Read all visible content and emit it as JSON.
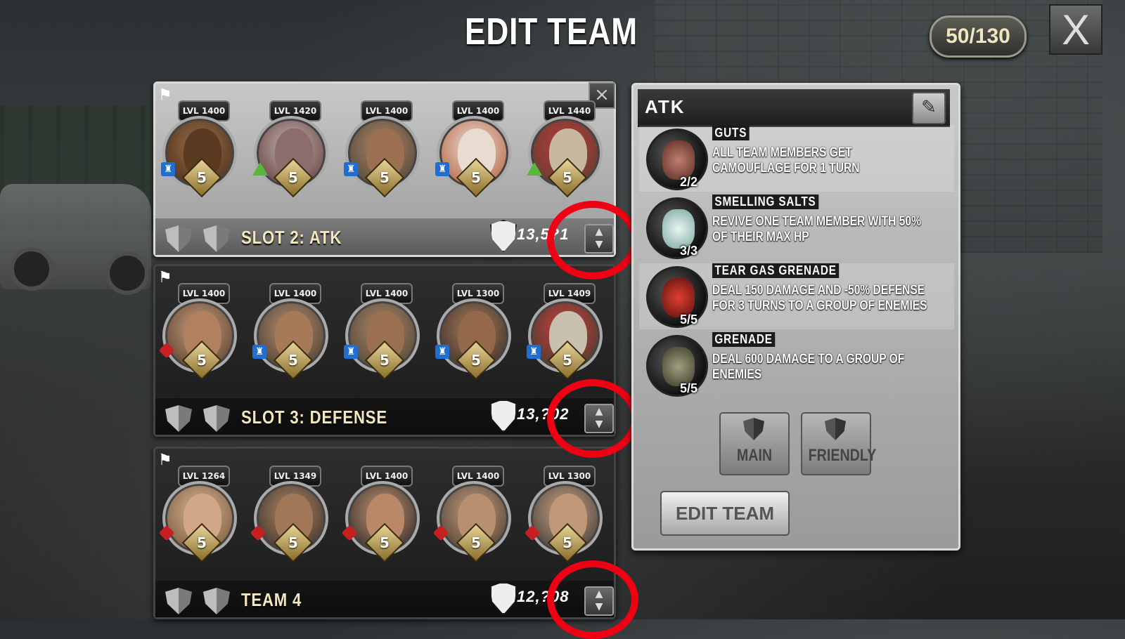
{
  "title": "EDIT TEAM",
  "capacity": "50/130",
  "close_label": "X",
  "teams": [
    {
      "label": "SLOT 2: ATK",
      "power": "13,5?1",
      "heroes": [
        {
          "level": "LVL 1400",
          "rank": "5",
          "class": "blue"
        },
        {
          "level": "LVL 1420",
          "rank": "5",
          "class": "green"
        },
        {
          "level": "LVL 1400",
          "rank": "5",
          "class": "blue"
        },
        {
          "level": "LVL 1400",
          "rank": "5",
          "class": "blue"
        },
        {
          "level": "LVL 1440",
          "rank": "5",
          "class": "green"
        }
      ]
    },
    {
      "label": "SLOT 3: DEFENSE",
      "power": "13,?02",
      "heroes": [
        {
          "level": "LVL 1400",
          "rank": "5",
          "class": "red"
        },
        {
          "level": "LVL 1400",
          "rank": "5",
          "class": "blue"
        },
        {
          "level": "LVL 1400",
          "rank": "5",
          "class": "blue"
        },
        {
          "level": "LVL 1300",
          "rank": "5",
          "class": "blue"
        },
        {
          "level": "LVL 1409",
          "rank": "5",
          "class": "blue"
        }
      ]
    },
    {
      "label": "TEAM 4",
      "power": "12,?08",
      "heroes": [
        {
          "level": "LVL 1264",
          "rank": "5",
          "class": "red"
        },
        {
          "level": "LVL 1349",
          "rank": "5",
          "class": "red"
        },
        {
          "level": "LVL 1400",
          "rank": "5",
          "class": "red"
        },
        {
          "level": "LVL 1400",
          "rank": "5",
          "class": "red"
        },
        {
          "level": "LVL 1300",
          "rank": "5",
          "class": "red"
        }
      ]
    }
  ],
  "skills_panel": {
    "title": "ATK",
    "skills": [
      {
        "name": "GUTS",
        "desc": "ALL TEAM MEMBERS GET CAMOUFLAGE FOR 1 TURN",
        "count": "2/2"
      },
      {
        "name": "SMELLING SALTS",
        "desc": "REVIVE ONE TEAM MEMBER WITH 50% OF THEIR MAX HP",
        "count": "3/3"
      },
      {
        "name": "TEAR GAS GRENADE",
        "desc": "DEAL 150 DAMAGE AND -50% DEFENSE FOR 3 TURNS TO A GROUP OF ENEMIES",
        "count": "5/5"
      },
      {
        "name": "GRENADE",
        "desc": "DEAL 600 DAMAGE TO A GROUP OF ENEMIES",
        "count": "5/5"
      }
    ],
    "main_label": "MAIN",
    "friendly_label": "FRIENDLY",
    "edit_team_label": "EDIT TEAM"
  },
  "colors": {
    "highlight_ring": "#f00013",
    "slot_label": "#f2e7bd",
    "class_blue": "#1e6fd1",
    "class_green": "#58b83a",
    "class_red": "#c72020"
  }
}
